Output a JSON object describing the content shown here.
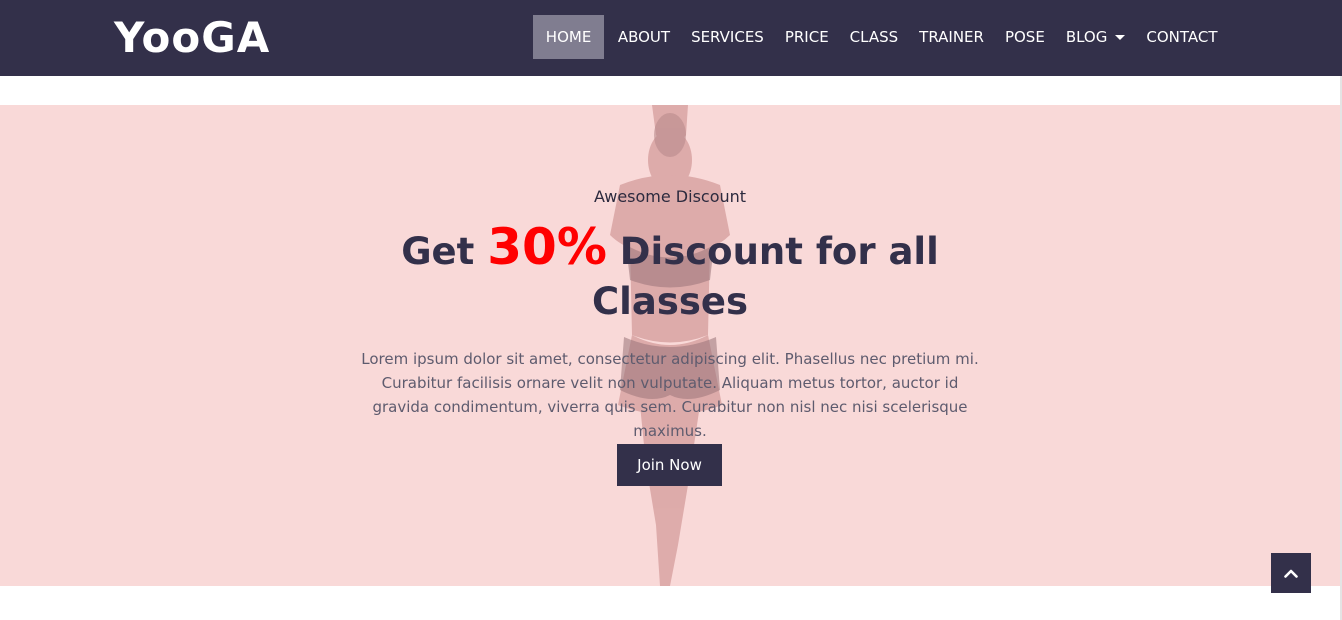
{
  "brand": {
    "name": "YooGA"
  },
  "nav": {
    "items": [
      {
        "label": "HOME",
        "active": true
      },
      {
        "label": "ABOUT"
      },
      {
        "label": "SERVICES"
      },
      {
        "label": "PRICE"
      },
      {
        "label": "CLASS"
      },
      {
        "label": "TRAINER"
      },
      {
        "label": "POSE"
      },
      {
        "label": "BLOG",
        "dropdown": true
      },
      {
        "label": "CONTACT"
      }
    ]
  },
  "hero": {
    "eyebrow": "Awesome Discount",
    "headline_pre": "Get ",
    "headline_highlight": "30%",
    "headline_post": " Discount for all Classes",
    "description": "Lorem ipsum dolor sit amet, consectetur adipiscing elit. Phasellus nec pretium mi. Curabitur facilisis ornare velit non vulputate. Aliquam metus tortor, auctor id gravida condimentum, viverra quis sem. Curabitur non nisl nec nisi scelerisque maximus.",
    "button_label": "Join Now"
  },
  "icons": {
    "scroll_top": "chevron-up-icon",
    "dropdown": "caret-down-icon"
  },
  "colors": {
    "navbar": "#33304a",
    "hero_bg": "#f9d9d8",
    "highlight": "#ff0000",
    "button": "#33304a",
    "active_nav": "#807d90"
  }
}
